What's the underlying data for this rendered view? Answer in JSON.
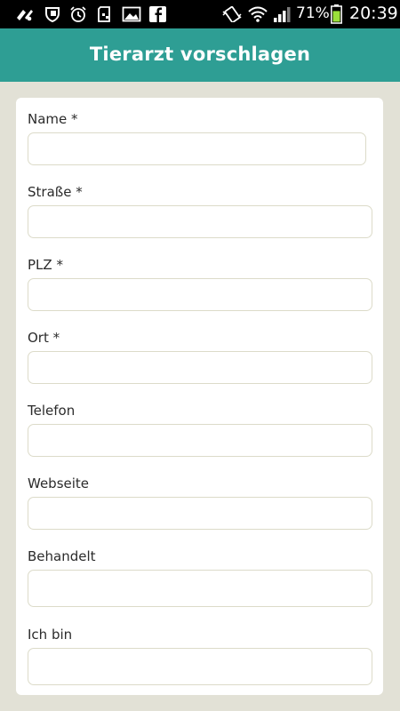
{
  "status_bar": {
    "battery_percent": "71%",
    "time": "20:39",
    "icons": [
      "nfc-icon",
      "shield-icon",
      "alarm-clock-icon",
      "sd-card-icon",
      "image-icon",
      "facebook-icon",
      "vibrate-icon",
      "wifi-icon",
      "signal-icon",
      "battery-icon"
    ],
    "battery_level": 0.71
  },
  "app_bar": {
    "title": "Tierarzt vorschlagen"
  },
  "form": {
    "fields": [
      {
        "label": "Name *",
        "value": ""
      },
      {
        "label": "Straße *",
        "value": ""
      },
      {
        "label": "PLZ *",
        "value": ""
      },
      {
        "label": "Ort *",
        "value": ""
      },
      {
        "label": "Telefon",
        "value": ""
      },
      {
        "label": "Webseite",
        "value": ""
      },
      {
        "label": "Behandelt",
        "value": ""
      },
      {
        "label": "Ich bin",
        "value": ""
      }
    ]
  },
  "colors": {
    "accent": "#2e9e94",
    "background": "#e2e1d6",
    "input_border": "#dcdbc9",
    "battery": "#9be03a"
  }
}
